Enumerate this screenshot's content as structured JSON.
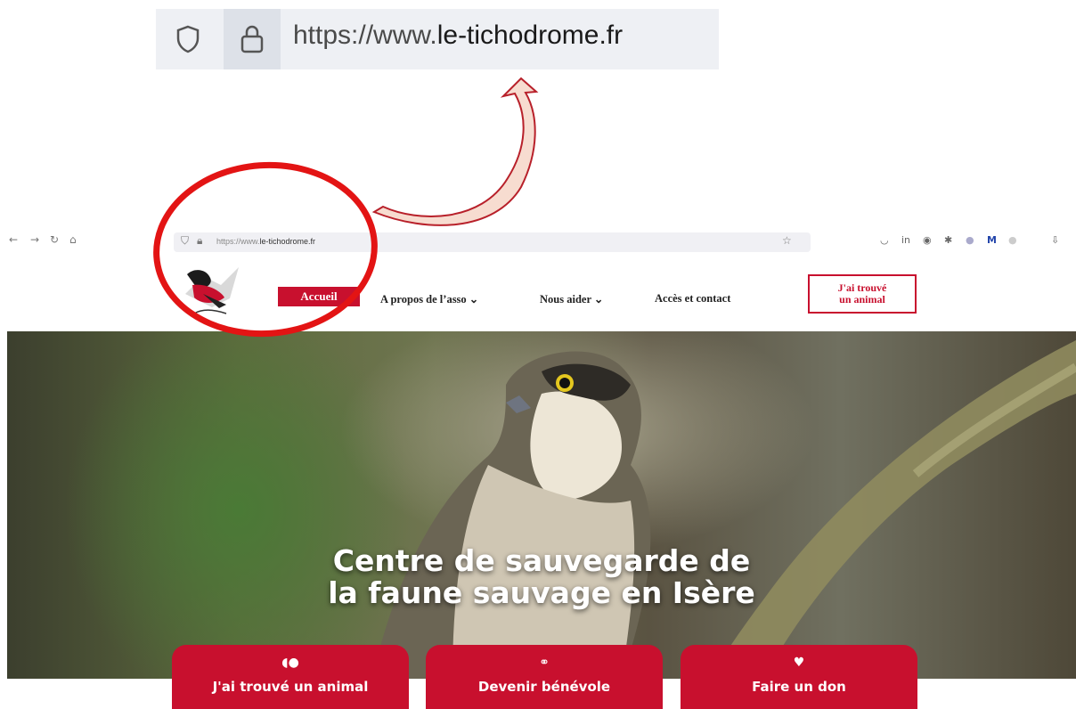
{
  "zoomed_address_bar": {
    "url_prefix": "https://www.",
    "url_domain": "le-tichodrome.fr",
    "icons": [
      "shield-icon",
      "lock-icon"
    ]
  },
  "browser_toolbar": {
    "url_prefix": "https://www.",
    "url_domain": "le-tichodrome.fr",
    "nav_icons": [
      "back-icon",
      "forward-icon",
      "reload-icon",
      "home-icon"
    ],
    "extension_icons": [
      "pocket-icon",
      "linkedin-icon",
      "account-icon",
      "extension-icon",
      "extension-dot-icon",
      "m-extension-icon",
      "extension-dot-icon",
      "download-icon"
    ]
  },
  "site_nav": {
    "logo_alt": "Le Tichodrome",
    "items": [
      {
        "label": "Accueil",
        "active": true
      },
      {
        "label": "A propos de l’asso",
        "has_dropdown": true
      },
      {
        "label": "Nous aider",
        "has_dropdown": true
      },
      {
        "label": "Accès et contact",
        "has_dropdown": false
      }
    ],
    "found_button": "J'ai trouvé un animal",
    "found_line1": "J'ai trouvé",
    "found_line2": "un animal",
    "chevron": "⌄"
  },
  "hero": {
    "title_line1": "Centre de sauvegarde de",
    "title_line2": "la faune sauvage en Isère",
    "image_subject": "falcon-perched-on-rope"
  },
  "cta_buttons": [
    {
      "label": "J'ai trouvé un animal",
      "icon": "hedgehog-icon"
    },
    {
      "label": "Devenir bénévole",
      "icon": "handshake-icon"
    },
    {
      "label": "Faire un don",
      "icon": "donate-icon"
    }
  ],
  "colors": {
    "brand_red": "#c8102e",
    "annotation_red": "#e31414"
  }
}
